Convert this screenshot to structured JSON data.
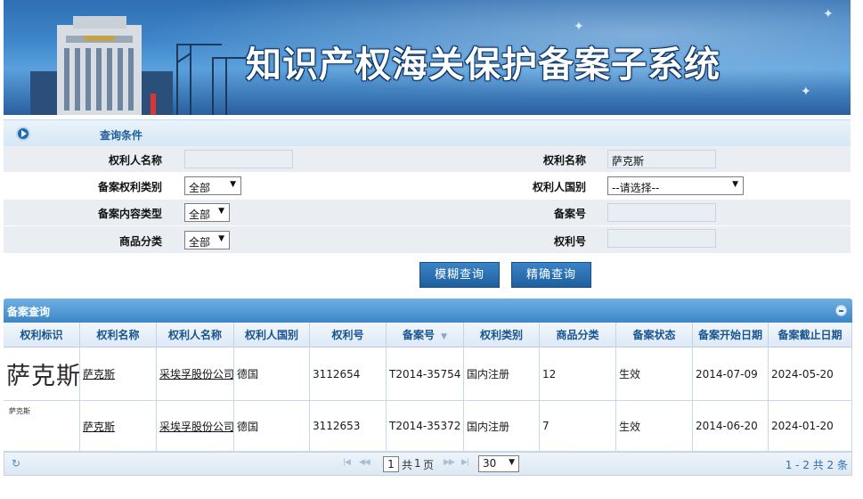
{
  "banner": {
    "title": "知识产权海关保护备案子系统"
  },
  "query": {
    "header": "查询条件",
    "fields": {
      "holder_name_label": "权利人名称",
      "holder_name_value": "",
      "right_name_label": "权利名称",
      "right_name_value": "萨克斯",
      "right_type_label": "备案权利类别",
      "right_type_value": "全部",
      "holder_country_label": "权利人国别",
      "holder_country_value": "--请选择--",
      "content_type_label": "备案内容类型",
      "content_type_value": "全部",
      "record_no_label": "备案号",
      "record_no_value": "",
      "goods_class_label": "商品分类",
      "goods_class_value": "全部",
      "right_no_label": "权利号",
      "right_no_value": ""
    },
    "buttons": {
      "fuzzy": "模糊查询",
      "exact": "精确查询"
    }
  },
  "results": {
    "title": "备案查询",
    "columns": [
      "权利标识",
      "权利名称",
      "权利人名称",
      "权利人国别",
      "权利号",
      "备案号",
      "权利类别",
      "商品分类",
      "备案状态",
      "备案开始日期",
      "备案截止日期"
    ],
    "rows": [
      {
        "mark": "萨克斯",
        "right_name": "萨克斯",
        "holder": "采埃孚股份公司",
        "country": "德国",
        "right_no": "3112654",
        "record_no": "T2014-35754",
        "right_type": "国内注册",
        "goods_class": "12",
        "status": "生效",
        "start_date": "2014-07-09",
        "end_date": "2024-05-20"
      },
      {
        "mark": "萨克斯",
        "right_name": "萨克斯",
        "holder": "采埃孚股份公司",
        "country": "德国",
        "right_no": "3112653",
        "record_no": "T2014-35372",
        "right_type": "国内注册",
        "goods_class": "7",
        "status": "生效",
        "start_date": "2014-06-20",
        "end_date": "2024-01-20"
      }
    ],
    "pager": {
      "page": "1",
      "page_label_pre": "共",
      "pages": "1",
      "page_label_post": "页",
      "page_size": "30",
      "summary": "1 - 2  共 2 条"
    }
  },
  "colors": {
    "accent": "#1f5f99",
    "header_blue": "#3c86c8"
  }
}
